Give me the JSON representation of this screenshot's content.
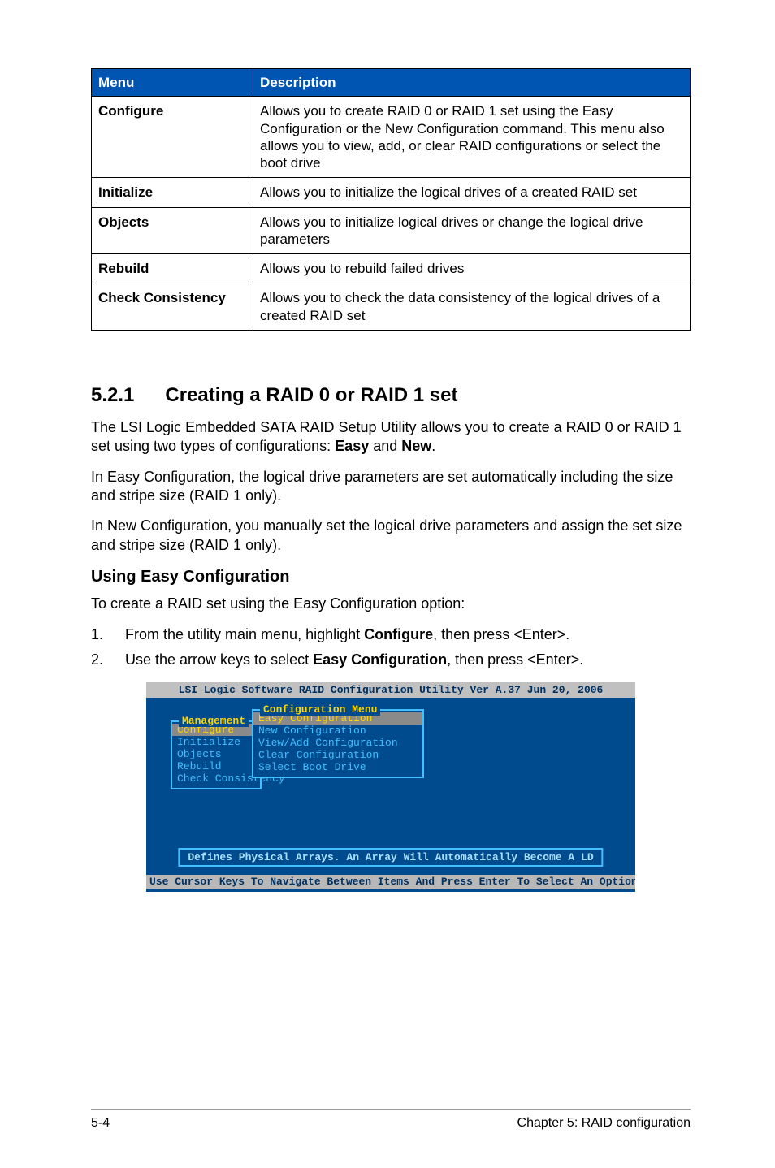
{
  "table": {
    "headers": {
      "menu": "Menu",
      "desc": "Description"
    },
    "rows": [
      {
        "menu": "Configure",
        "desc": "Allows you to create RAID 0 or RAID 1 set using the Easy Configuration or the New Configuration command. This menu also allows you to view, add, or clear RAID configurations or select the boot drive"
      },
      {
        "menu": "Initialize",
        "desc": "Allows you to initialize the logical drives of a created RAID set"
      },
      {
        "menu": "Objects",
        "desc": "Allows you to initialize logical drives or change the logical drive parameters"
      },
      {
        "menu": "Rebuild",
        "desc": "Allows you to rebuild failed drives"
      },
      {
        "menu": "Check Consistency",
        "desc": "Allows you to check the data consistency of the logical drives of a created RAID set"
      }
    ]
  },
  "section": {
    "number": "5.2.1",
    "title": "Creating a RAID 0 or RAID 1 set"
  },
  "para1_a": "The LSI Logic Embedded SATA RAID Setup Utility allows you to create a RAID 0 or RAID 1 set using two types of configurations: ",
  "para1_b": "Easy",
  "para1_c": " and ",
  "para1_d": "New",
  "para1_e": ".",
  "para2": "In Easy Configuration, the logical drive parameters are set automatically including the size and stripe size (RAID 1 only).",
  "para3": "In New Configuration, you manually set the logical drive parameters and assign the set size and stripe size (RAID 1 only).",
  "subheading": "Using Easy Configuration",
  "para4": "To create a RAID set using the Easy Configuration option:",
  "steps": [
    {
      "n": "1.",
      "pre": "From the utility main menu, highlight ",
      "bold": "Configure",
      "post": ", then press <Enter>."
    },
    {
      "n": "2.",
      "pre": "Use the arrow keys to select ",
      "bold": "Easy Configuration",
      "post": ", then press <Enter>."
    }
  ],
  "shot": {
    "title": "LSI Logic Software RAID Configuration Utility Ver A.37 Jun 20, 2006",
    "mgmt_title": "Management",
    "mgmt_items": [
      "Configure",
      "Initialize",
      "Objects",
      "Rebuild",
      "Check Consistency"
    ],
    "mgmt_selected": 0,
    "conf_title": "Configuration Menu",
    "conf_items": [
      "Easy Configuration",
      "New Configuration",
      "View/Add Configuration",
      "Clear Configuration",
      "Select Boot Drive"
    ],
    "conf_selected": 0,
    "status": "Defines Physical Arrays. An Array Will Automatically Become A LD",
    "hint": "Use Cursor Keys To Navigate Between Items And Press Enter To Select An Option"
  },
  "footer": {
    "left": "5-4",
    "right": "Chapter 5: RAID configuration"
  }
}
